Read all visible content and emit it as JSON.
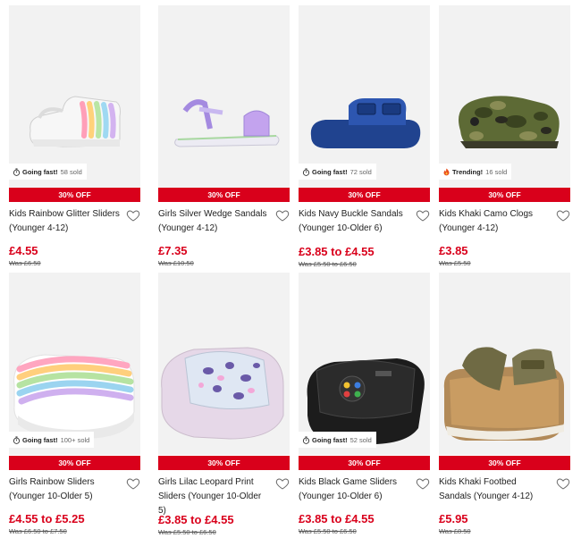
{
  "products": [
    {
      "name": "Kids Rainbow Glitter Sliders (Younger 4-12)",
      "badge": "30% OFF",
      "price": "£4.55",
      "was": "Was £6.50",
      "social": {
        "icon": "stopwatch-icon",
        "label": "Going fast!",
        "count": "58 sold"
      }
    },
    {
      "name": "Girls Silver Wedge Sandals (Younger 4-12)",
      "badge": "30% OFF",
      "price": "£7.35",
      "was": "Was £10.50",
      "social": null
    },
    {
      "name": "Kids Navy Buckle Sandals (Younger 10-Older 6)",
      "badge": "30% OFF",
      "price": "£3.85 to £4.55",
      "was": "Was £5.50 to £6.50",
      "social": {
        "icon": "stopwatch-icon",
        "label": "Going fast!",
        "count": "72 sold"
      }
    },
    {
      "name": "Kids Khaki Camo Clogs (Younger 4-12)",
      "badge": "30% OFF",
      "price": "£3.85",
      "was": "Was £5.50",
      "social": {
        "icon": "flame-icon",
        "label": "Trending!",
        "count": "16 sold"
      }
    },
    {
      "name": "Girls Rainbow Sliders (Younger 10-Older 5)",
      "badge": "30% OFF",
      "price": "£4.55 to £5.25",
      "was": "Was £6.50 to £7.50",
      "social": {
        "icon": "stopwatch-icon",
        "label": "Going fast!",
        "count": "100+ sold"
      }
    },
    {
      "name": "Girls Lilac Leopard Print Sliders (Younger 10-Older 5)",
      "badge": "30% OFF",
      "price": "£3.85 to £4.55",
      "was": "Was £5.50 to £6.50",
      "social": null
    },
    {
      "name": "Kids Black Game Sliders (Younger 10-Older 6)",
      "badge": "30% OFF",
      "price": "£3.85 to £4.55",
      "was": "Was £5.50 to £6.50",
      "social": {
        "icon": "stopwatch-icon",
        "label": "Going fast!",
        "count": "52 sold"
      }
    },
    {
      "name": "Kids Khaki Footbed Sandals (Younger 4-12)",
      "badge": "30% OFF",
      "price": "£5.95",
      "was": "Was £8.50",
      "social": null
    }
  ],
  "colors": {
    "accent": "#d9001b",
    "image_bg": "#f2f2f2",
    "text": "#222222",
    "muted": "#555555"
  }
}
